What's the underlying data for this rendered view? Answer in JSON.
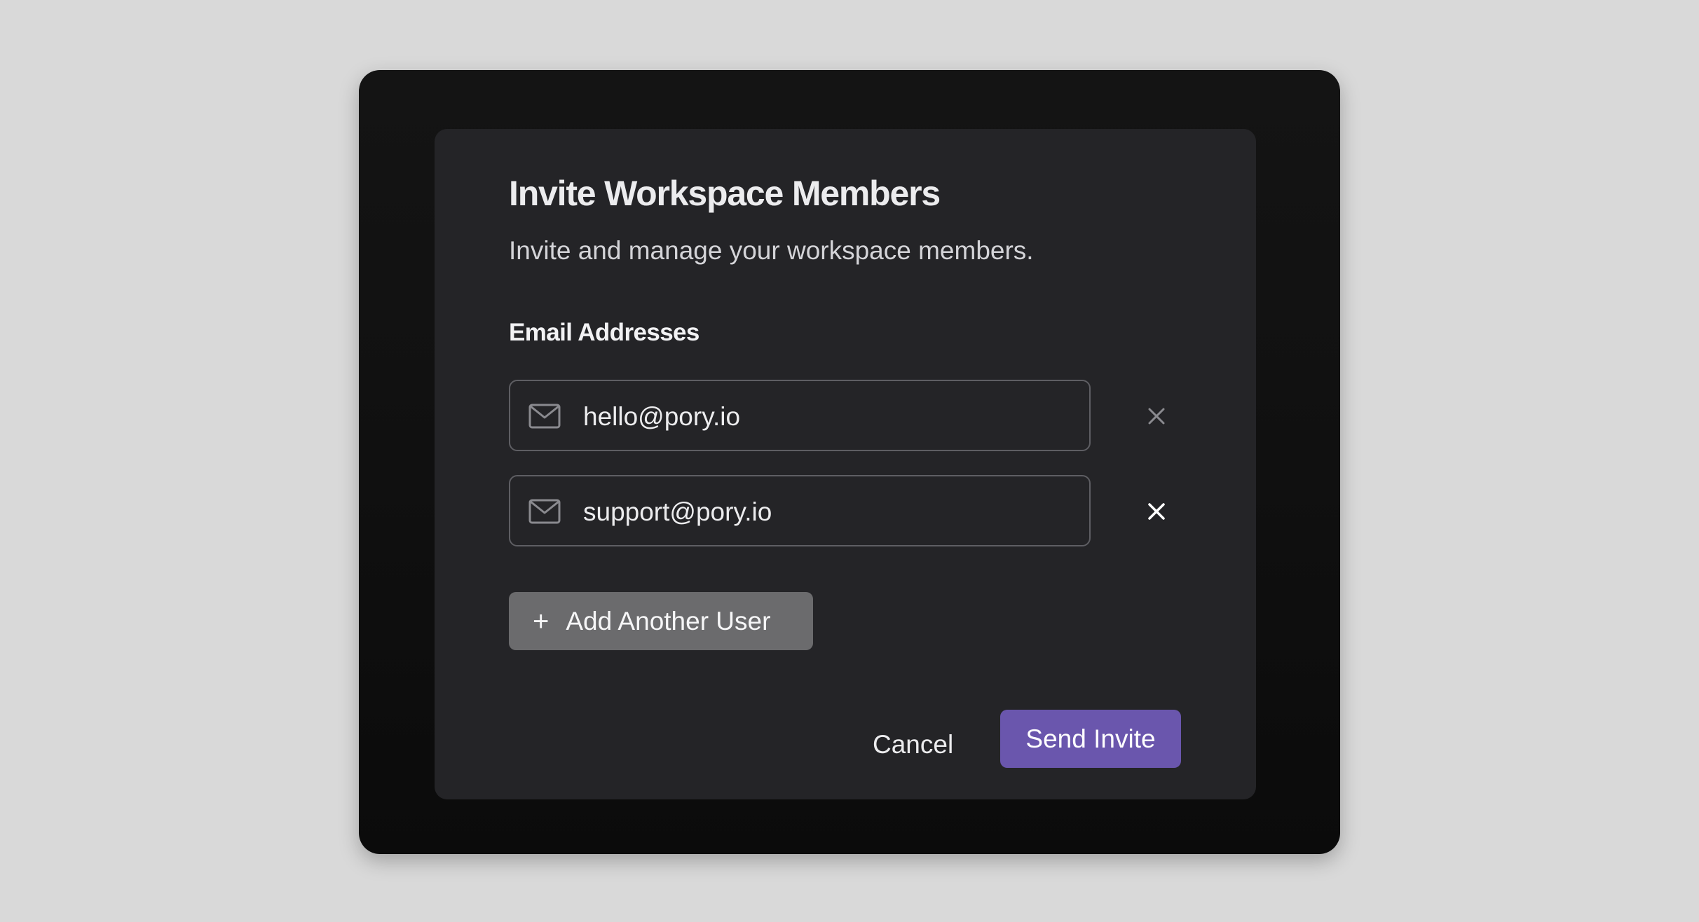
{
  "dialog": {
    "title": "Invite Workspace Members",
    "subtitle": "Invite and manage your workspace members.",
    "email_label": "Email Addresses",
    "emails": [
      {
        "value": "hello@pory.io",
        "icon": "mail-icon",
        "remove_icon": "close-icon",
        "remove_color": "#8a8a8f"
      },
      {
        "value": "support@pory.io",
        "icon": "mail-icon",
        "remove_icon": "close-icon",
        "remove_color": "#ffffff"
      }
    ],
    "add_user_label": "Add Another User",
    "add_user_icon": "plus-icon",
    "cancel_label": "Cancel",
    "send_label": "Send Invite"
  },
  "colors": {
    "page_background": "#d9d9d9",
    "frame_background": "#111111",
    "modal_background": "#242427",
    "accent": "#6a56ad",
    "secondary_button": "#6b6b6d"
  }
}
